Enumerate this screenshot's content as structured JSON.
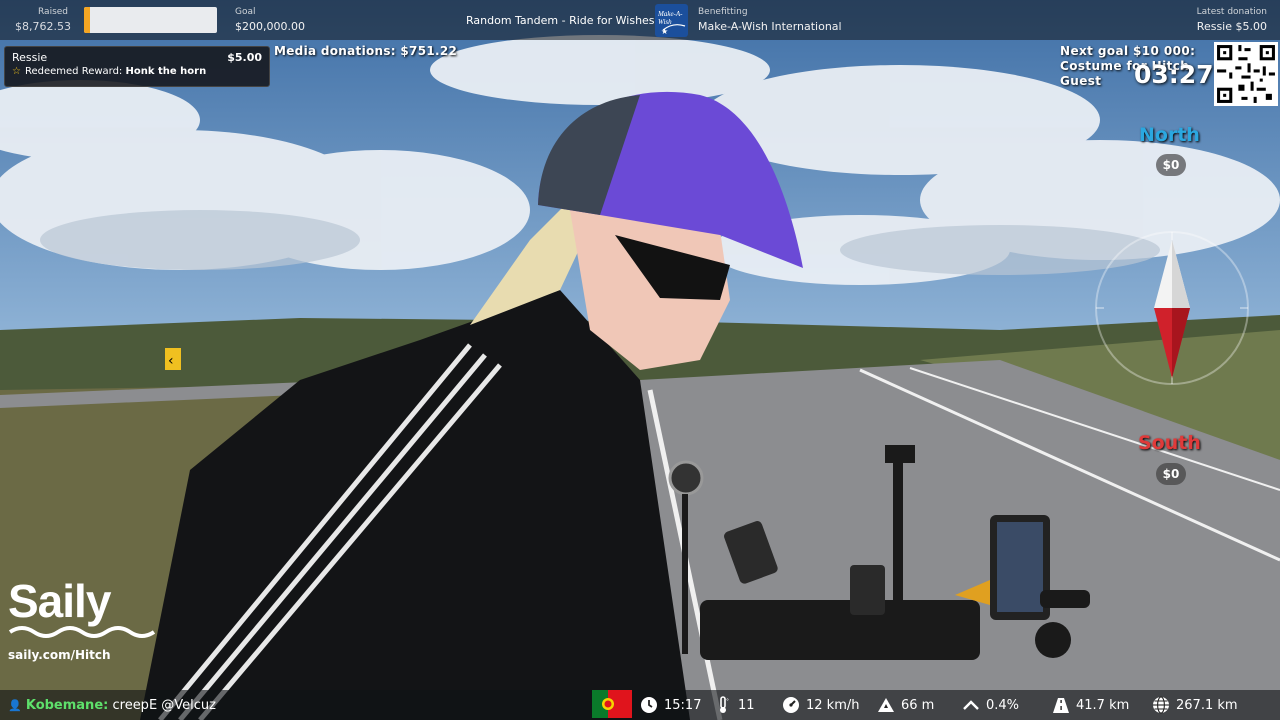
{
  "topbar": {
    "raised_label": "Raised",
    "raised_value": "$8,762.53",
    "progress_fraction": 0.044,
    "goal_label": "Goal",
    "goal_value": "$200,000.00",
    "stream_title": "Random Tandem - Ride for Wishes",
    "charity_logo_text": "Make-A-Wish",
    "benefitting_label": "Benefitting",
    "benefitting_value": "Make-A-Wish International",
    "latest_label": "Latest donation",
    "latest_value": "Ressie $5.00"
  },
  "alert": {
    "name": "Ressie",
    "amount": "$5.00",
    "reward_prefix": "Redeemed Reward:",
    "reward_name": "Honk the horn"
  },
  "media_donations": "Media donations: $751.22",
  "next_goal": {
    "line1": "Next goal $10 000:",
    "line2": "Costume for Hitch",
    "line3": "Guest"
  },
  "timer": "03:27",
  "vote": {
    "north_label": "North",
    "north_amount": "$0",
    "south_label": "South",
    "south_amount": "$0",
    "north_color": "#2aa8e0",
    "south_color": "#e03a3a"
  },
  "sponsor": {
    "brand": "Saily",
    "url": "saily.com/Hitch"
  },
  "chat": {
    "user": "Kobemane:",
    "message": "creepE @Velcuz",
    "user_color": "#5ee06b"
  },
  "stats": {
    "time": "15:17",
    "temperature": "11",
    "speed": "12 km/h",
    "altitude": "66 m",
    "gradient": "0.4%",
    "distance_today": "41.7 km",
    "distance_total": "267.1 km"
  },
  "icons": [
    "person-icon",
    "star-icon",
    "clock-icon",
    "thermometer-icon",
    "speedometer-icon",
    "mountain-icon",
    "gradient-icon",
    "road-icon",
    "globe-icon",
    "compass-icon",
    "portugal-flag-icon",
    "qr-code-icon"
  ]
}
